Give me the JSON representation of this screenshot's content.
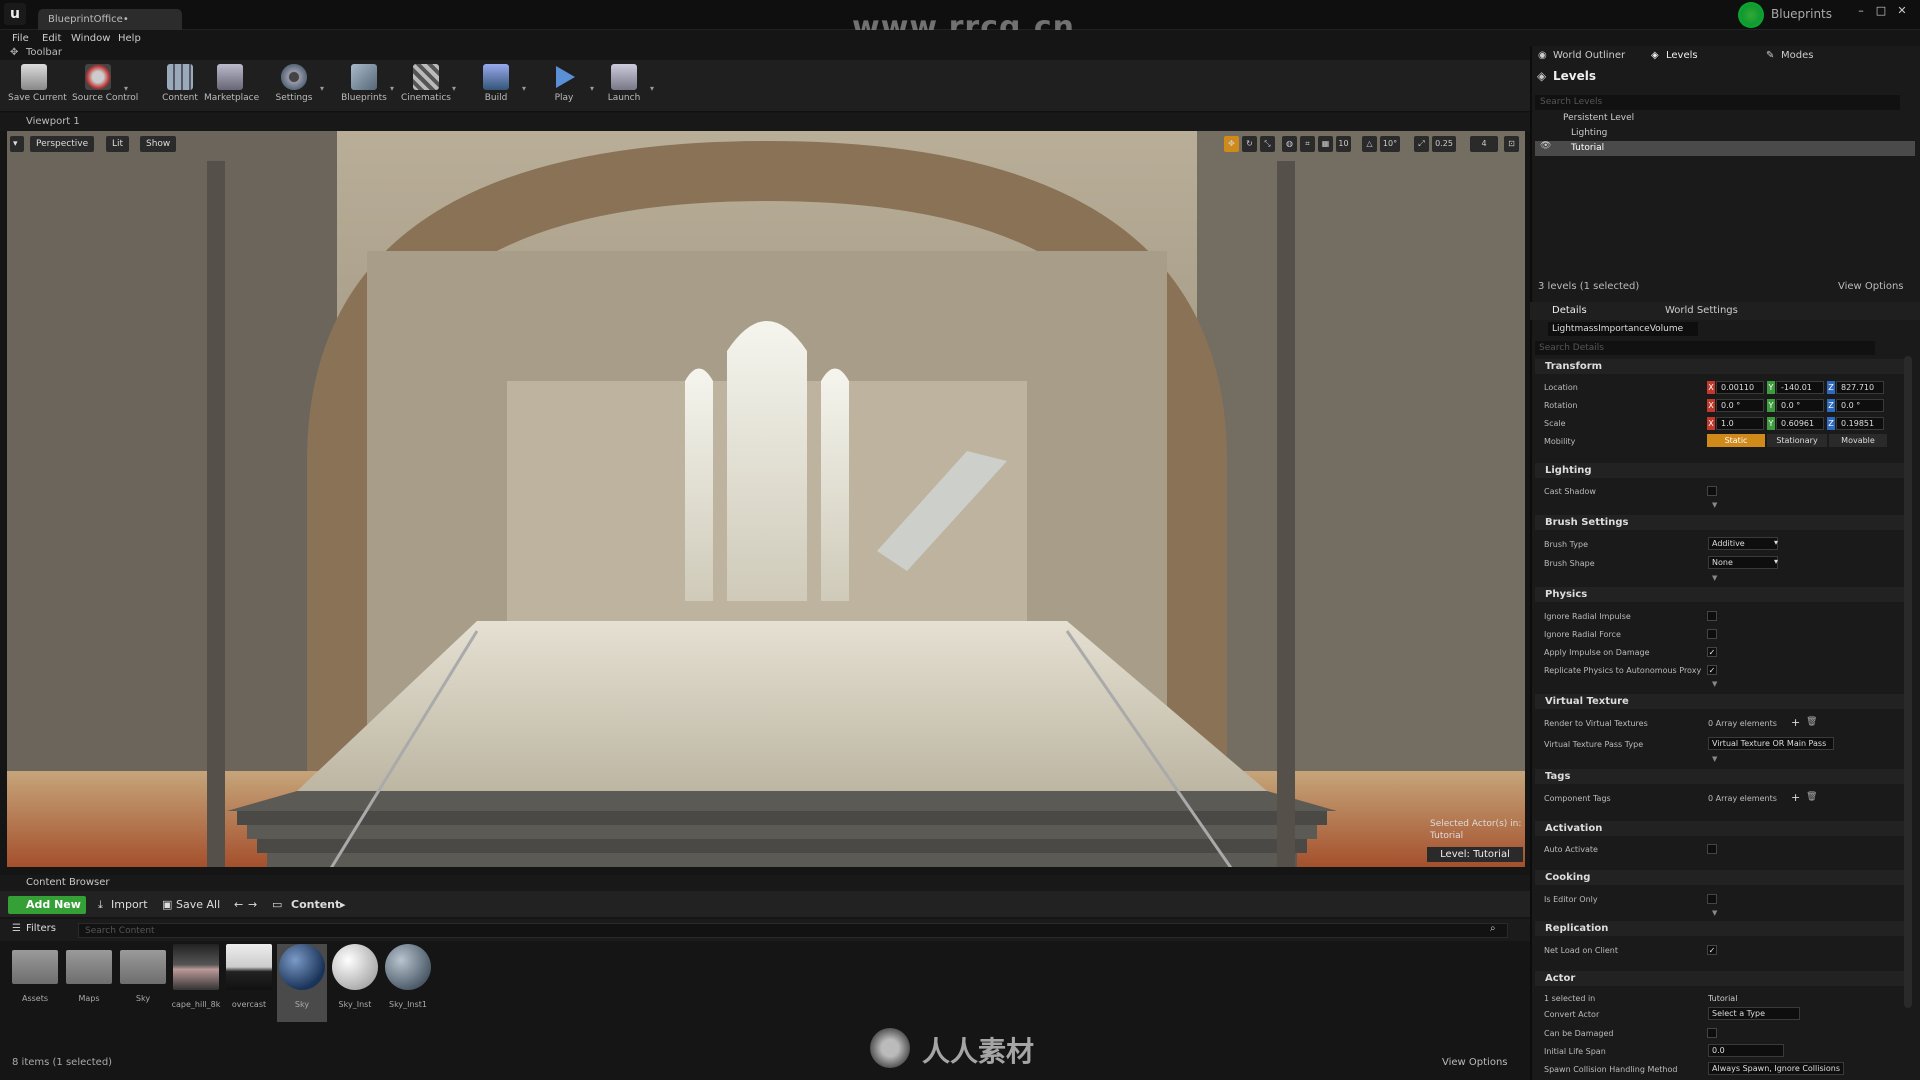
{
  "app": {
    "logo": "u",
    "doc_tab": "BlueprintOffice•",
    "brand_label": "Blueprints",
    "watermark_url": "www.rrcg.cn",
    "watermark_bottom": "人人素材",
    "watermark_logo": "RRCG"
  },
  "menu": [
    "File",
    "Edit",
    "Window",
    "Help"
  ],
  "toolbar_tab": "Toolbar",
  "toolbar": [
    {
      "label": "Save Current",
      "icon": "save-icon"
    },
    {
      "label": "Source Control",
      "icon": "source-control-icon"
    },
    {
      "label": "Content",
      "icon": "content-icon"
    },
    {
      "label": "Marketplace",
      "icon": "marketplace-icon"
    },
    {
      "label": "Settings",
      "icon": "settings-icon"
    },
    {
      "label": "Blueprints",
      "icon": "blueprints-icon"
    },
    {
      "label": "Cinematics",
      "icon": "cinematics-icon"
    },
    {
      "label": "Build",
      "icon": "build-icon"
    },
    {
      "label": "Play",
      "icon": "play-icon"
    },
    {
      "label": "Launch",
      "icon": "launch-icon"
    }
  ],
  "viewport": {
    "tab": "Viewport 1",
    "perspective": "Perspective",
    "lit": "Lit",
    "show": "Show",
    "grid_snap": "10",
    "rot_snap": "10°",
    "scale_snap": "0.25",
    "cam_speed": "4",
    "selected_note_1": "Selected Actor(s) in:",
    "selected_note_2": "Tutorial",
    "level_label": "Level: Tutorial"
  },
  "content_browser": {
    "tab": "Content Browser",
    "add_new": "Add New",
    "import": "Import",
    "save_all": "Save All",
    "path": "Content",
    "filters": "Filters",
    "search_placeholder": "Search Content",
    "assets": [
      {
        "name": "Assets",
        "kind": "folder"
      },
      {
        "name": "Maps",
        "kind": "folder"
      },
      {
        "name": "Sky",
        "kind": "folder"
      },
      {
        "name": "cape_hill_8k",
        "kind": "hdri-dark"
      },
      {
        "name": "overcast",
        "kind": "hdri-light"
      },
      {
        "name": "Sky",
        "kind": "sphere-blue",
        "selected": true
      },
      {
        "name": "Sky_Inst",
        "kind": "sphere-white"
      },
      {
        "name": "Sky_Inst1",
        "kind": "sphere-grey"
      }
    ],
    "status": "8 items (1 selected)",
    "view_options": "View Options"
  },
  "outliner": {
    "tabs": [
      "World Outliner",
      "Levels",
      "Modes"
    ],
    "header": "Levels",
    "search_placeholder": "Search Levels",
    "rows": [
      "Persistent Level",
      "Lighting",
      "Tutorial"
    ],
    "status": "3 levels (1 selected)",
    "view_options": "View Options"
  },
  "details": {
    "tabs": [
      "Details",
      "World Settings"
    ],
    "actor_name": "LightmassImportanceVolume",
    "search_placeholder": "Search Details",
    "sections": {
      "transform": "Transform",
      "lighting": "Lighting",
      "brush": "Brush Settings",
      "physics": "Physics",
      "virtual_texture": "Virtual Texture",
      "tags": "Tags",
      "activation": "Activation",
      "cooking": "Cooking",
      "replication": "Replication",
      "actor": "Actor"
    },
    "location_label": "Location",
    "rotation_label": "Rotation",
    "scale_label": "Scale",
    "location": [
      "0.00110",
      "-140.01",
      "827.710"
    ],
    "rotation": [
      "0.0 °",
      "0.0 °",
      "0.0 °"
    ],
    "scale": [
      "1.0",
      "0.60961",
      "0.19851"
    ],
    "mobility_label": "Mobility",
    "mobility": [
      "Static",
      "Stationary",
      "Movable"
    ],
    "cast_shadow": "Cast Shadow",
    "brush_type_label": "Brush Type",
    "brush_type": "Additive",
    "brush_shape_label": "Brush Shape",
    "brush_shape": "None",
    "physics_props": [
      {
        "label": "Ignore Radial Impulse",
        "checked": false
      },
      {
        "label": "Ignore Radial Force",
        "checked": false
      },
      {
        "label": "Apply Impulse on Damage",
        "checked": true
      },
      {
        "label": "Replicate Physics to Autonomous Proxy",
        "checked": true
      }
    ],
    "render_vt_label": "Render to Virtual Textures",
    "render_vt_value": "0 Array elements",
    "vt_pass_label": "Virtual Texture Pass Type",
    "vt_pass_value": "Virtual Texture OR Main Pass",
    "component_tags_label": "Component Tags",
    "component_tags_value": "0 Array elements",
    "auto_activate": "Auto Activate",
    "editor_only": "Is Editor Only",
    "net_load": "Net Load on Client",
    "selected_in_label": "1 selected in",
    "selected_in_value": "Tutorial",
    "convert_actor_label": "Convert Actor",
    "convert_actor_value": "Select a Type",
    "can_be_damaged": "Can be Damaged",
    "life_span_label": "Initial Life Span",
    "life_span_value": "0.0",
    "spawn_label": "Spawn Collision Handling Method",
    "spawn_value": "Always Spawn, Ignore Collisions"
  },
  "colors": {
    "accent_green": "#35a035",
    "axis_x": "#c0392b",
    "axis_y": "#3d9c3d",
    "axis_z": "#2e6bc0",
    "static_orange": "#d08a1a"
  }
}
